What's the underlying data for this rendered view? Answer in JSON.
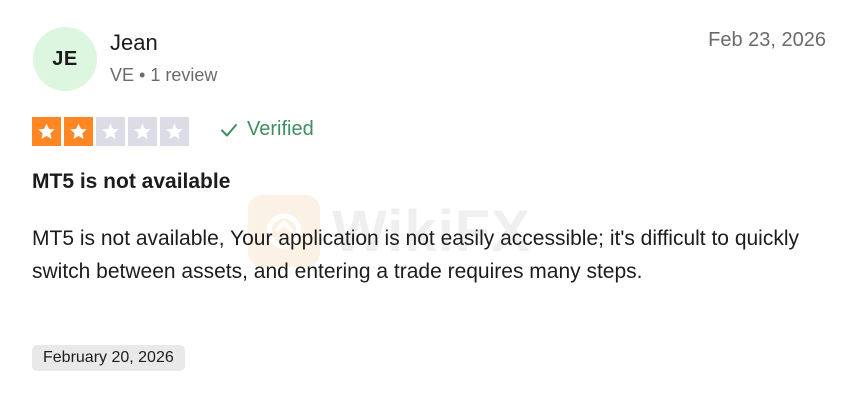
{
  "review": {
    "author": {
      "initials": "JE",
      "name": "Jean",
      "meta": "VE • 1 review"
    },
    "date": "Feb 23, 2026",
    "rating": {
      "value": 2,
      "max": 5
    },
    "verified_label": "Verified",
    "title": "MT5 is not available",
    "body": "MT5 is not available, Your application is not easily accessible; it's difficult to quickly switch between assets, and entering a trade requires many steps.",
    "experience_date": "February 20, 2026"
  },
  "watermark": {
    "text": "WikiFX"
  },
  "colors": {
    "star_filled": "#ff8622",
    "star_empty": "#dcdce6",
    "avatar_bg": "#dcf6df",
    "verified_green": "#3f8f5f"
  },
  "icons": {
    "star": "star-icon",
    "verified": "checkmark-icon",
    "watermark_logo": "wikifx-logo-icon"
  }
}
